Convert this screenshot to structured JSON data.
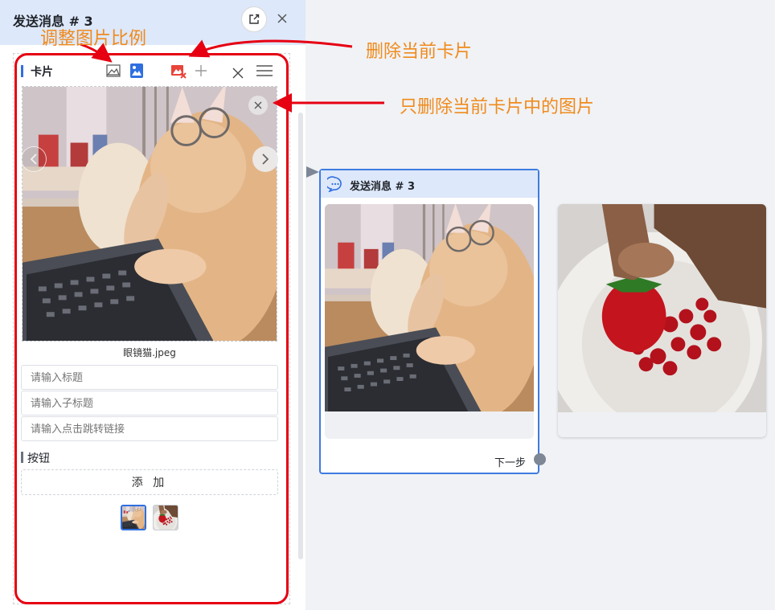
{
  "panel": {
    "title": "发送消息 # 3",
    "card_label": "卡片",
    "image_filename": "眼镜猫.jpeg",
    "title_placeholder": "请输入标题",
    "subtitle_placeholder": "请输入子标题",
    "link_placeholder": "请输入点击跳转链接",
    "buttons_label": "按钮",
    "add_button_label": "添 加"
  },
  "annotations": {
    "adjust_ratio": "调整图片比例",
    "delete_card": "删除当前卡片",
    "delete_image_only": "只删除当前卡片中的图片"
  },
  "node": {
    "title": "发送消息 # 3",
    "next_label": "下一步"
  },
  "colors": {
    "accent": "#2f6fe0",
    "annotation": "#f08a1c",
    "highlight_frame": "#e60012"
  },
  "icons": [
    "edit-icon",
    "close-icon",
    "image-ratio-landscape-icon",
    "image-ratio-square-icon",
    "delete-card-icon",
    "add-icon",
    "menu-icon",
    "chevron-left-icon",
    "chevron-right-icon",
    "chat-bubble-icon"
  ]
}
